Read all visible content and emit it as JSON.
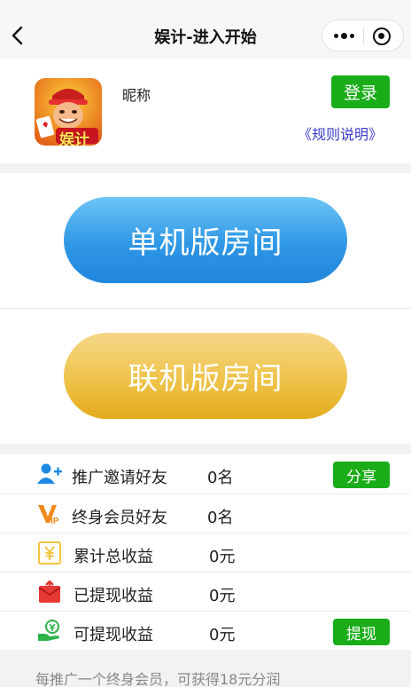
{
  "navbar": {
    "title": "娱计-进入开始"
  },
  "profile": {
    "avatar_text": "娱计",
    "nickname": "昵称",
    "login_label": "登录",
    "rules_link": "《规则说明》"
  },
  "rooms": {
    "single_label": "单机版房间",
    "online_label": "联机版房间"
  },
  "list": {
    "rows": [
      {
        "icon": "add-user-icon",
        "label": "推广邀请好友",
        "value": "0名",
        "button": "分享"
      },
      {
        "icon": "vip-icon",
        "label": "终身会员好友",
        "value": "0名"
      },
      {
        "icon": "yuan-icon",
        "label": "累计总收益",
        "value": "0元"
      },
      {
        "icon": "red-envelope-icon",
        "label": "已提现收益",
        "value": "0元"
      },
      {
        "icon": "withdraw-hand-icon",
        "label": "可提现收益",
        "value": "0元",
        "button": "提现"
      }
    ]
  },
  "footer": {
    "note": "每推广一个终身会员，可获得18元分润"
  },
  "colors": {
    "green": "#1aad19",
    "blue": "#1f86dc",
    "gold": "#e4ab1c",
    "link": "#3b3bc8"
  }
}
